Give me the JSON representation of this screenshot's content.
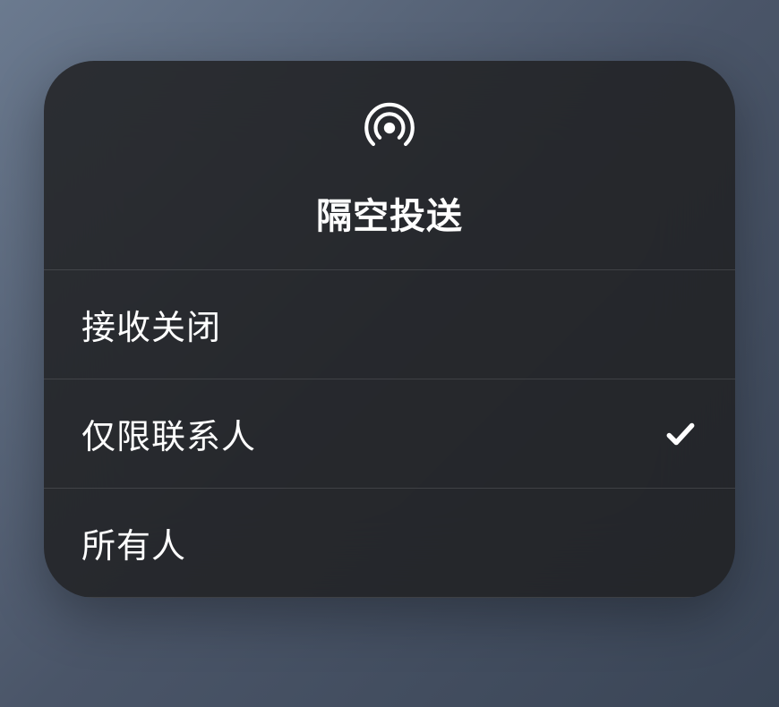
{
  "panel": {
    "title": "隔空投送",
    "options": [
      {
        "label": "接收关闭",
        "selected": false
      },
      {
        "label": "仅限联系人",
        "selected": true
      },
      {
        "label": "所有人",
        "selected": false
      }
    ]
  }
}
